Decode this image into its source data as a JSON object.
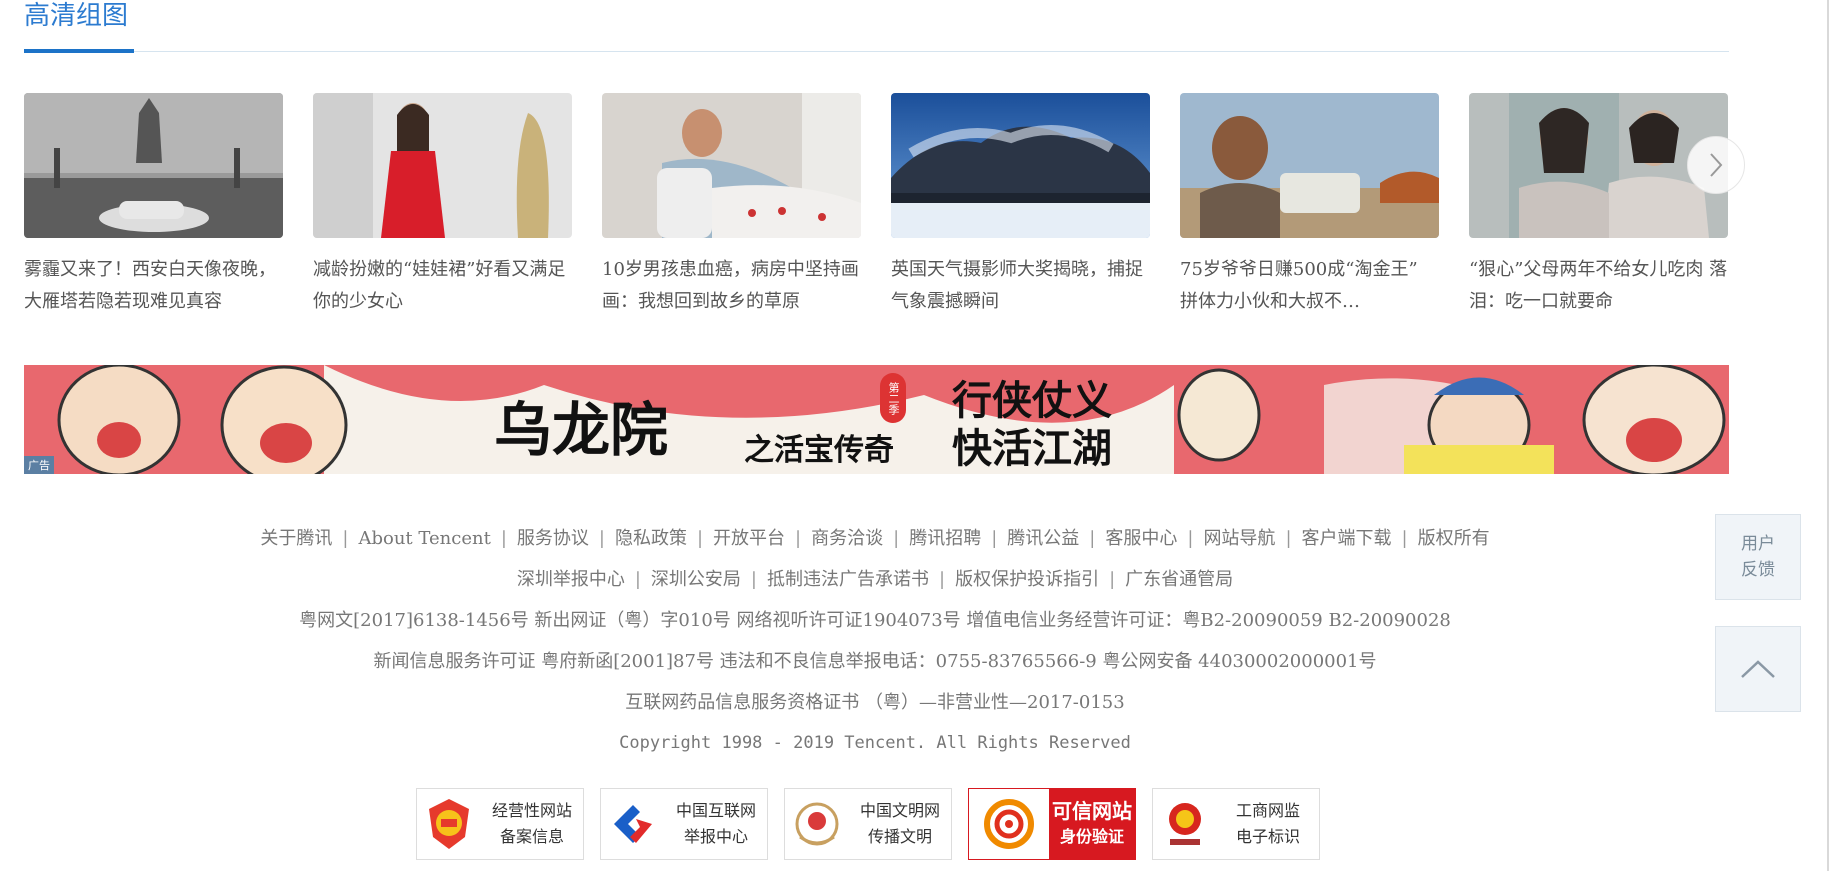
{
  "section": {
    "title": "高清组图"
  },
  "gallery": {
    "cards": [
      {
        "caption": "雾霾又来了！西安白天像夜晚，大雁塔若隐若现难见真容"
      },
      {
        "caption": "减龄扮嫩的“娃娃裙”好看又满足你的少女心"
      },
      {
        "caption": "10岁男孩患血癌，病房中坚持画画：我想回到故乡的草原"
      },
      {
        "caption": "英国天气摄影师大奖揭晓，捕捉气象震撼瞬间"
      },
      {
        "caption": "75岁爷爷日赚500成“淘金王” 拼体力小伙和大叔不…"
      },
      {
        "caption": "“狠心”父母两年不给女儿吃肉 落泪：吃一口就要命"
      }
    ],
    "next_icon": "chevron-right-icon"
  },
  "banner": {
    "title_main": "乌龙院",
    "title_sub": "之活宝传奇",
    "season": "第二季",
    "slogan_line1": "行侠仗义",
    "slogan_line2": "快活江湖",
    "ad_badge": "广告"
  },
  "footer": {
    "links_row1": [
      "关于腾讯",
      "About Tencent",
      "服务协议",
      "隐私政策",
      "开放平台",
      "商务洽谈",
      "腾讯招聘",
      "腾讯公益",
      "客服中心",
      "网站导航",
      "客户端下载",
      "版权所有"
    ],
    "links_row2": [
      "深圳举报中心",
      "深圳公安局",
      "抵制违法广告承诺书",
      "版权保护投诉指引",
      "广东省通管局"
    ],
    "license1": "粤网文[2017]6138-1456号 新出网证（粤）字010号 网络视听许可证1904073号 增值电信业务经营许可证：粤B2-20090059 B2-20090028",
    "license2": "新闻信息服务许可证 粤府新函[2001]87号 违法和不良信息举报电话：0755-83765566-9 粤公网安备 44030002000001号",
    "license3": "互联网药品信息服务资格证书 （粤）—非营业性—2017-0153",
    "copyright": "Copyright 1998 - 2019 Tencent. All Rights Reserved",
    "badges": [
      {
        "line1": "经营性网站",
        "line2": "备案信息"
      },
      {
        "line1": "中国互联网",
        "line2": "举报中心"
      },
      {
        "line1": "中国文明网",
        "line2": "传播文明"
      },
      {
        "line1": "可信网站",
        "line2": "身份验证"
      },
      {
        "line1": "工商网监",
        "line2": "电子标识"
      }
    ]
  },
  "side": {
    "feedback_line1": "用户",
    "feedback_line2": "反馈"
  },
  "colors": {
    "accent": "#1c73c8",
    "banner_bg": "#e8686e"
  }
}
